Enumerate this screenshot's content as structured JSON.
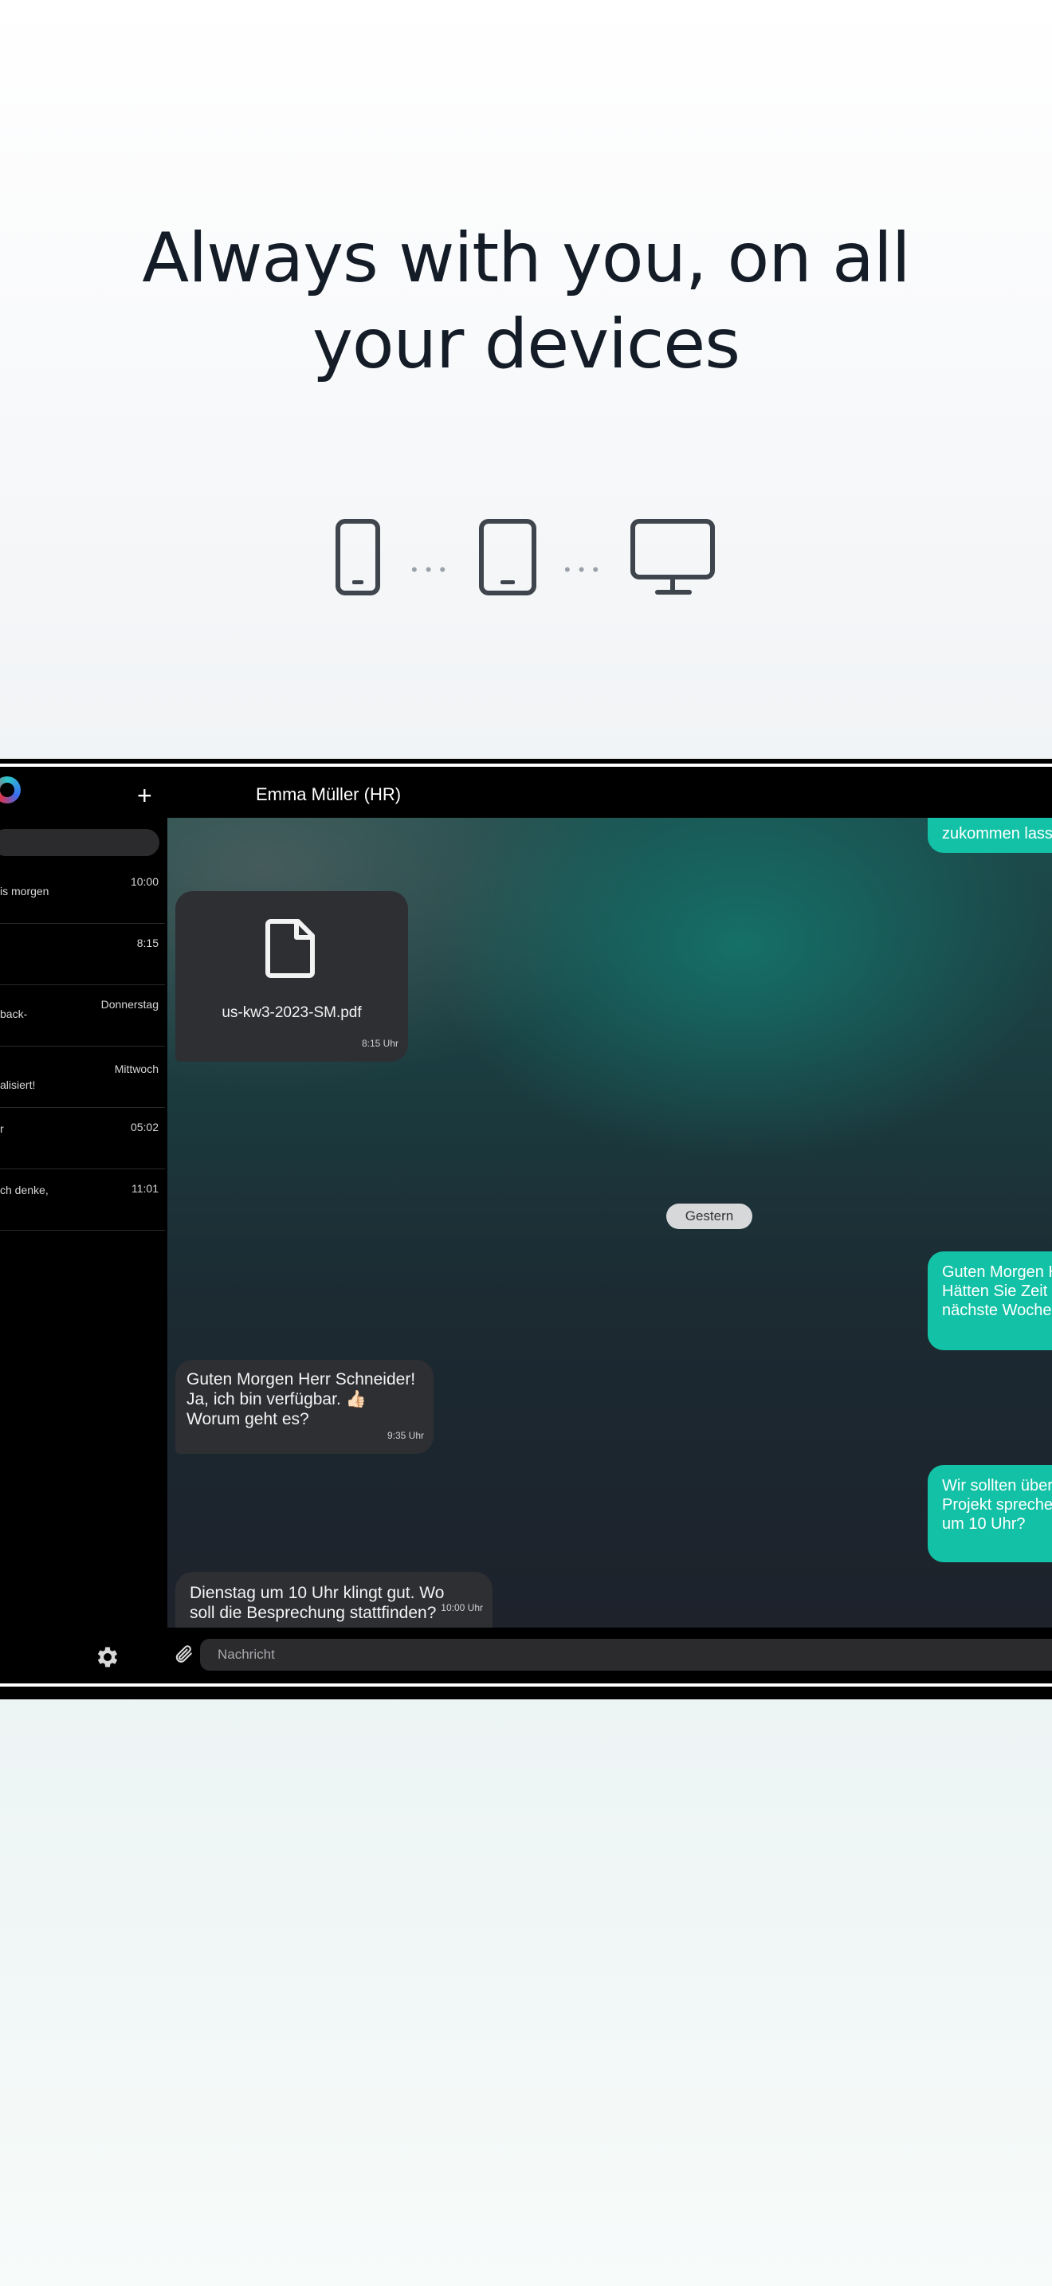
{
  "hero": {
    "headline_line1": "Always with you, on all",
    "headline_line2": "your devices"
  },
  "device_icons": [
    "smartphone-icon",
    "tablet-icon",
    "monitor-icon"
  ],
  "sidebar": {
    "new_chat_icon": "+",
    "chats": [
      {
        "preview": "is morgen",
        "time": "10:00"
      },
      {
        "preview": "",
        "time": "8:15"
      },
      {
        "preview": "back-",
        "time": "Donnerstag"
      },
      {
        "preview": "alisiert!",
        "time": "Mittwoch"
      },
      {
        "preview": "r",
        "time": "05:02"
      },
      {
        "preview": "ch denke,",
        "time": "11:01"
      }
    ]
  },
  "conversation": {
    "title": "Emma Müller (HR)",
    "messages": [
      {
        "type": "out",
        "text": "zukommen lasse"
      },
      {
        "type": "file",
        "file_name": "us-kw3-2023-SM.pdf",
        "time": "8:15 Uhr"
      },
      {
        "type": "date",
        "text": "Gestern"
      },
      {
        "type": "out",
        "lines": [
          "Guten Morgen H",
          "Hätten Sie Zeit",
          "nächste Woche"
        ]
      },
      {
        "type": "in",
        "lines": [
          "Guten Morgen Herr Schneider!",
          "Ja, ich bin verfügbar. 👍🏻",
          "Worum geht es?"
        ],
        "time": "9:35 Uhr"
      },
      {
        "type": "out",
        "lines": [
          "Wir sollten über",
          "Projekt spreche",
          "um 10 Uhr?"
        ]
      },
      {
        "type": "in",
        "lines": [
          "Dienstag um 10 Uhr klingt gut. Wo",
          "soll die Besprechung stattfinden?"
        ],
        "time": "10:00 Uhr"
      }
    ]
  },
  "composer": {
    "placeholder": "Nachricht"
  },
  "colors": {
    "accent": "#13c2a6",
    "incoming_bubble": "#2e2f33",
    "headline": "#141c27"
  }
}
